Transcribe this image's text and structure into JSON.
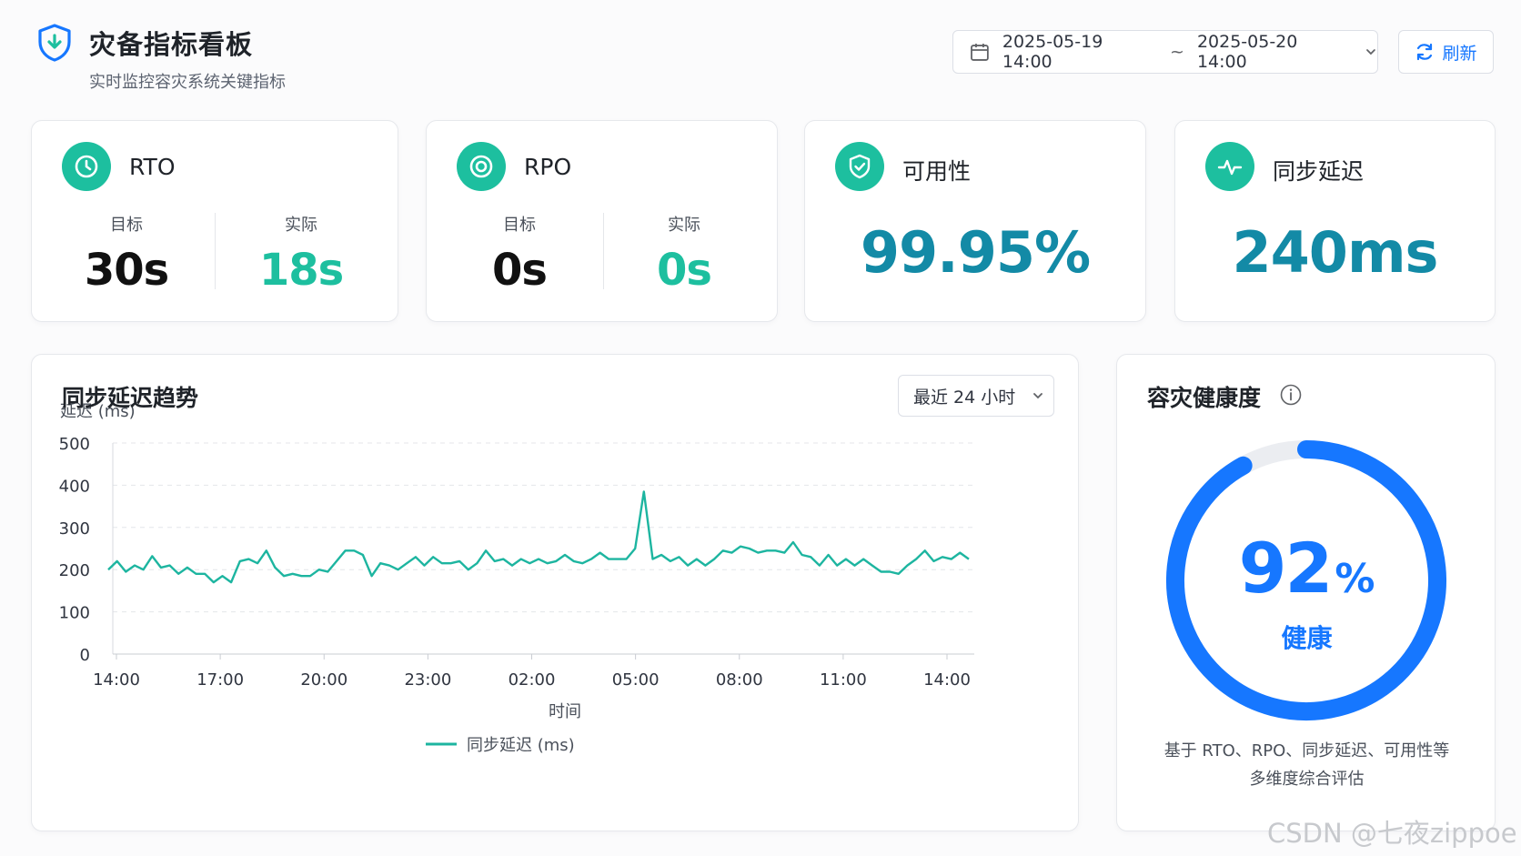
{
  "header": {
    "title": "灾备指标看板",
    "subtitle": "实时监控容灾系统关键指标",
    "date_start": "2025-05-19 14:00",
    "date_sep": "~",
    "date_end": "2025-05-20 14:00",
    "refresh_label": "刷新"
  },
  "metrics": {
    "rto": {
      "title": "RTO",
      "target_label": "目标",
      "target": "30s",
      "actual_label": "实际",
      "actual": "18s"
    },
    "rpo": {
      "title": "RPO",
      "target_label": "目标",
      "target": "0s",
      "actual_label": "实际",
      "actual": "0s"
    },
    "availability": {
      "title": "可用性",
      "value": "99.95%"
    },
    "sync_delay": {
      "title": "同步延迟",
      "value": "240ms"
    }
  },
  "trend": {
    "title": "同步延迟趋势",
    "range_label": "最近 24 小时"
  },
  "chart_data": {
    "type": "line",
    "ylabel": "延迟 (ms)",
    "xlabel": "时间",
    "ylim": [
      0,
      500
    ],
    "yticks": [
      "0",
      "100",
      "200",
      "300",
      "400",
      "500"
    ],
    "xticks": [
      "14:00",
      "17:00",
      "20:00",
      "23:00",
      "02:00",
      "05:00",
      "08:00",
      "11:00",
      "14:00"
    ],
    "grid": true,
    "legend_position": "bottom",
    "series": [
      {
        "name": "同步延迟 (ms)",
        "color": "#1db5a0",
        "values": [
          200,
          220,
          195,
          210,
          200,
          232,
          205,
          210,
          190,
          205,
          190,
          190,
          170,
          185,
          170,
          220,
          225,
          215,
          245,
          205,
          185,
          190,
          185,
          185,
          200,
          195,
          220,
          245,
          245,
          235,
          185,
          215,
          210,
          200,
          215,
          230,
          210,
          230,
          215,
          215,
          220,
          200,
          215,
          245,
          220,
          225,
          210,
          225,
          215,
          225,
          215,
          220,
          235,
          220,
          215,
          225,
          240,
          225,
          225,
          225,
          250,
          385,
          225,
          235,
          220,
          230,
          210,
          225,
          210,
          225,
          245,
          240,
          255,
          250,
          240,
          245,
          245,
          240,
          265,
          235,
          230,
          210,
          235,
          210,
          225,
          210,
          225,
          210,
          195,
          195,
          190,
          210,
          225,
          245,
          220,
          230,
          225,
          240,
          225
        ]
      }
    ]
  },
  "health": {
    "title": "容灾健康度",
    "value": "92",
    "unit": "%",
    "percent": 92,
    "status": "健康",
    "desc_line1": "基于 RTO、RPO、同步延迟、可用性等",
    "desc_line2": "多维度综合评估"
  },
  "watermark": "CSDN @七夜zippoe",
  "colors": {
    "accent_teal": "#1dbf9f",
    "accent_blue": "#1677ff",
    "big_value": "#138aa6"
  }
}
